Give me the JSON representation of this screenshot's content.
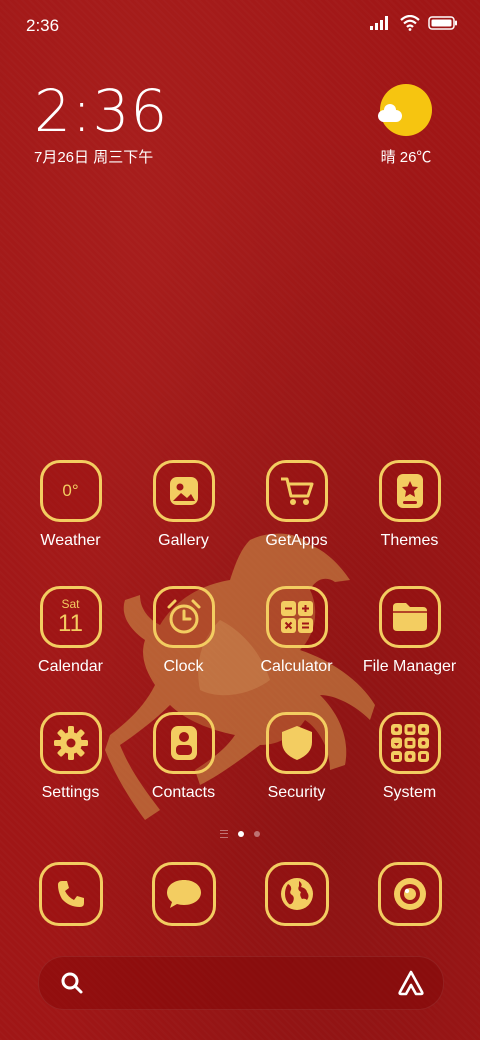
{
  "status_bar": {
    "time": "2:36"
  },
  "clock_widget": {
    "time": "2:36",
    "date": "7月26日 周三下午"
  },
  "weather_widget": {
    "condition": "晴",
    "temperature": "26℃"
  },
  "apps": [
    {
      "name": "Weather",
      "icon_text": "0°"
    },
    {
      "name": "Gallery"
    },
    {
      "name": "GetApps"
    },
    {
      "name": "Themes"
    },
    {
      "name": "Calendar",
      "icon_day": "Sat",
      "icon_date": "11"
    },
    {
      "name": "Clock"
    },
    {
      "name": "Calculator"
    },
    {
      "name": "File Manager"
    },
    {
      "name": "Settings"
    },
    {
      "name": "Contacts"
    },
    {
      "name": "Security"
    },
    {
      "name": "System"
    }
  ],
  "page_indicator": {
    "current": 1,
    "total": 2
  },
  "dock": [
    "phone",
    "messages",
    "browser",
    "camera"
  ],
  "colors": {
    "background": "#a01616",
    "accent": "#f3cd61",
    "weather_sun": "#f6c510"
  }
}
